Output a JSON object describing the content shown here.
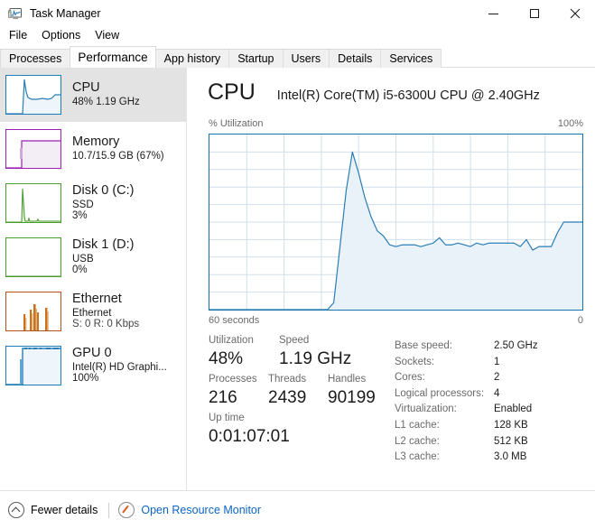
{
  "window": {
    "title": "Task Manager",
    "icon": "task-manager-icon",
    "controls": {
      "minimize": "minimize-icon",
      "maximize": "maximize-icon",
      "close": "close-icon"
    }
  },
  "menu": {
    "items": [
      {
        "label": "File"
      },
      {
        "label": "Options"
      },
      {
        "label": "View"
      }
    ]
  },
  "tabs": [
    {
      "label": "Processes",
      "active": false
    },
    {
      "label": "Performance",
      "active": true
    },
    {
      "label": "App history",
      "active": false
    },
    {
      "label": "Startup",
      "active": false
    },
    {
      "label": "Users",
      "active": false
    },
    {
      "label": "Details",
      "active": false
    },
    {
      "label": "Services",
      "active": false
    }
  ],
  "sidebar": {
    "items": [
      {
        "name": "CPU",
        "title": "CPU",
        "sub1": "48%  1.19 GHz",
        "sub2": "",
        "selected": true,
        "color": "#1f7cbb",
        "fill": "#eef5fb"
      },
      {
        "name": "Memory",
        "title": "Memory",
        "sub1": "10.7/15.9 GB (67%)",
        "sub2": "",
        "selected": false,
        "color": "#9b21b5",
        "fill": "#f3eef5"
      },
      {
        "name": "Disk 0 (C:)",
        "title": "Disk 0 (C:)",
        "sub1": "SSD",
        "sub2": "3%",
        "selected": false,
        "color": "#4a9c2d",
        "fill": "#eef6ea"
      },
      {
        "name": "Disk 1 (D:)",
        "title": "Disk 1 (D:)",
        "sub1": "USB",
        "sub2": "0%",
        "selected": false,
        "color": "#4a9c2d",
        "fill": "#eef6ea"
      },
      {
        "name": "Ethernet",
        "title": "Ethernet",
        "sub1": "Ethernet",
        "sub2": "S: 0 R: 0 Kbps",
        "selected": false,
        "color": "#b5541a",
        "fill": "#f8efe8"
      },
      {
        "name": "GPU 0",
        "title": "GPU 0",
        "sub1": "Intel(R) HD Graphi...",
        "sub2": "100%",
        "selected": false,
        "color": "#1f7cbb",
        "fill": "#eef5fb"
      }
    ]
  },
  "main": {
    "title": "CPU",
    "model": "Intel(R) Core(TM) i5-6300U CPU @ 2.40GHz",
    "graph": {
      "y_label": "% Utilization",
      "y_max_label": "100%",
      "x_left_label": "60 seconds",
      "x_right_label": "0",
      "line_color": "#2a7db5",
      "fill_color": "#eaf2f9",
      "grid_color": "#cfe0ee",
      "border_color": "#1473ac"
    },
    "stats": {
      "utilization_label": "Utilization",
      "utilization_value": "48%",
      "speed_label": "Speed",
      "speed_value": "1.19 GHz",
      "processes_label": "Processes",
      "processes_value": "216",
      "threads_label": "Threads",
      "threads_value": "2439",
      "handles_label": "Handles",
      "handles_value": "90199",
      "uptime_label": "Up time",
      "uptime_value": "0:01:07:01"
    },
    "specs": [
      {
        "label": "Base speed:",
        "value": "2.50 GHz"
      },
      {
        "label": "Sockets:",
        "value": "1"
      },
      {
        "label": "Cores:",
        "value": "2"
      },
      {
        "label": "Logical processors:",
        "value": "4"
      },
      {
        "label": "Virtualization:",
        "value": "Enabled"
      },
      {
        "label": "L1 cache:",
        "value": "128 KB"
      },
      {
        "label": "L2 cache:",
        "value": "512 KB"
      },
      {
        "label": "L3 cache:",
        "value": "3.0 MB"
      }
    ]
  },
  "statusbar": {
    "fewer_details_label": "Fewer details",
    "fewer_details_icon": "chevron-up-circle-icon",
    "resource_monitor_label": "Open Resource Monitor",
    "resource_monitor_icon": "resource-monitor-icon",
    "link_color": "#0b63c5"
  },
  "chart_data": {
    "type": "area",
    "title": "% Utilization",
    "xlabel": "60 seconds",
    "ylabel": "% Utilization",
    "ylim": [
      0,
      100
    ],
    "xlim": [
      60,
      0
    ],
    "grid": true,
    "legend": false,
    "series": [
      {
        "name": "CPU Utilization",
        "x": [
          60,
          59,
          58,
          57,
          56,
          55,
          54,
          53,
          52,
          51,
          50,
          49,
          48,
          47,
          46,
          45,
          44,
          43,
          42,
          41,
          40,
          39,
          38,
          37,
          36,
          35,
          34,
          33,
          32,
          31,
          30,
          29,
          28,
          27,
          26,
          25,
          24,
          23,
          22,
          21,
          20,
          19,
          18,
          17,
          16,
          15,
          14,
          13,
          12,
          11,
          10,
          9,
          8,
          7,
          6,
          5,
          4,
          3,
          2,
          1,
          0
        ],
        "values": [
          0,
          0,
          0,
          0,
          0,
          0,
          0,
          0,
          0,
          0,
          0,
          0,
          0,
          0,
          0,
          0,
          0,
          0,
          0,
          0,
          4,
          36,
          68,
          90,
          78,
          64,
          53,
          45,
          42,
          37,
          36,
          37,
          37,
          37,
          36,
          37,
          38,
          41,
          37,
          37,
          38,
          37,
          36,
          38,
          37,
          38,
          38,
          38,
          38,
          38,
          36,
          40,
          34,
          36,
          36,
          36,
          44,
          50,
          50,
          50,
          50
        ]
      }
    ]
  }
}
